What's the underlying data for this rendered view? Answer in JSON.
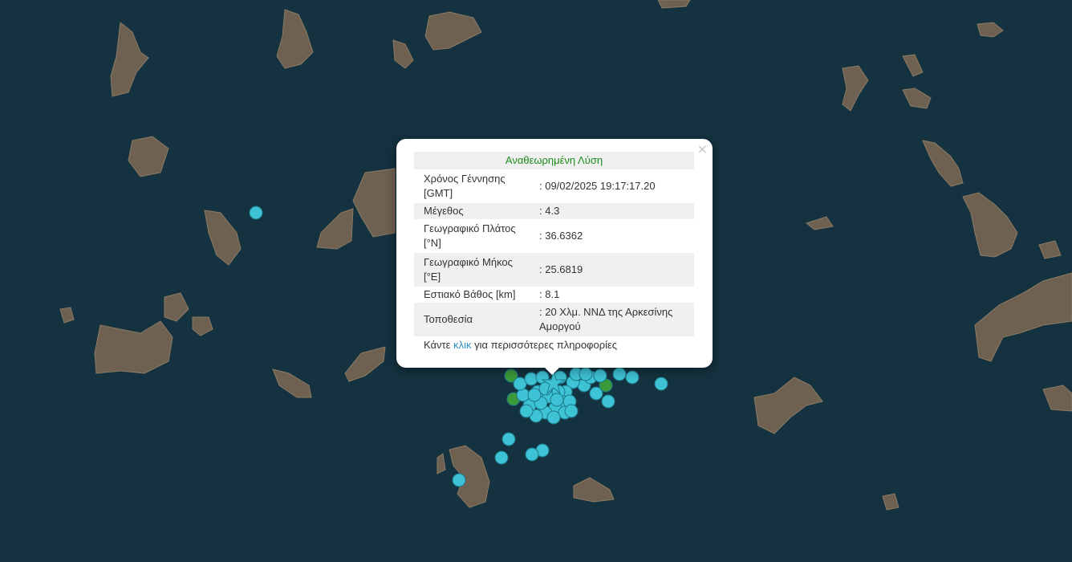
{
  "popup": {
    "title": "Αναθεωρημένη Λύση",
    "close_symbol": "×",
    "rows": [
      {
        "label": "Χρόνος Γέννησης [GMT]",
        "value": ": 09/02/2025 19:17:17.20"
      },
      {
        "label": "Μέγεθος",
        "value": ": 4.3"
      },
      {
        "label": "Γεωγραφικό Πλάτος [°N]",
        "value": ": 36.6362"
      },
      {
        "label": "Γεωγραφικό Μήκος [°E]",
        "value": ": 25.6819"
      },
      {
        "label": "Εστιακό Βάθος [km]",
        "value": ": 8.1"
      },
      {
        "label": "Τοποθεσία",
        "value": ": 20 Χλμ. ΝΝΔ της Αρκεσίνης Αμοργού"
      }
    ],
    "more_prefix": "Κάντε ",
    "more_link": "κλικ",
    "more_suffix": " για περισσότερες πληροφορίες"
  },
  "colors": {
    "sea": "#14323f",
    "land": "#6f6152",
    "quake_marker": "#3ec3d6",
    "quake_marker_recent": "#3a9a3a",
    "selected_star": "#3ec3d6",
    "popup_title": "#1a8c1a"
  },
  "icons": {
    "selected_event": "star-icon",
    "close": "close-icon"
  }
}
